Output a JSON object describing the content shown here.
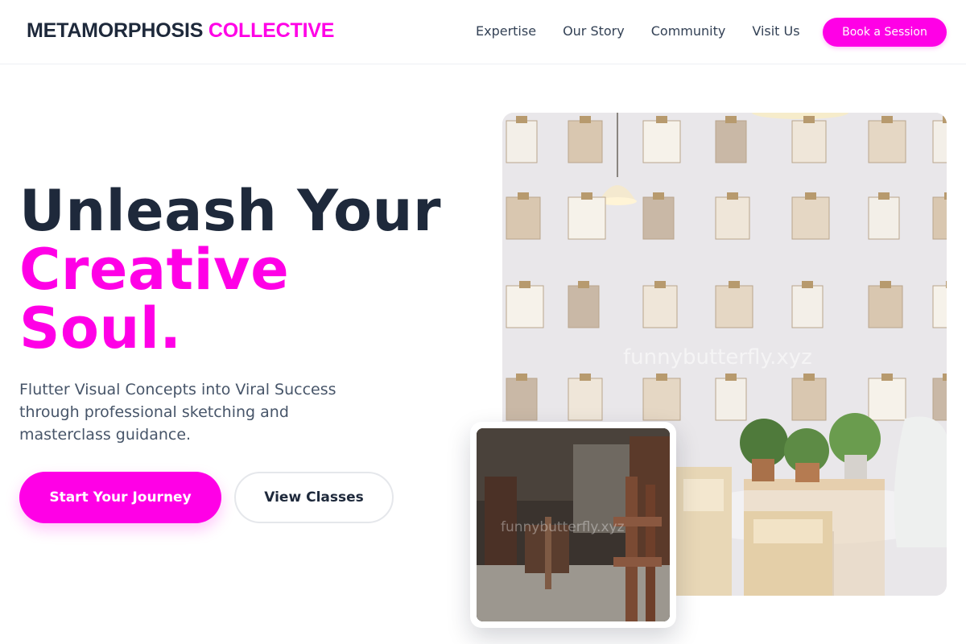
{
  "brand": {
    "part1": "METAMORPHOSIS",
    "part2": "COLLECTIVE"
  },
  "nav": {
    "items": [
      "Expertise",
      "Our Story",
      "Community",
      "Visit Us"
    ],
    "cta": "Book a Session"
  },
  "hero": {
    "headline_line1": "Unleash Your",
    "headline_line2": "Creative",
    "headline_line3": "Soul.",
    "subtext": "Flutter Visual Concepts into Viral Success through professional sketching and masterclass guidance.",
    "primary_cta": "Start Your Journey",
    "secondary_cta": "View Classes"
  },
  "images": {
    "main_alt": "Gallery wall with clipboards of magazines and a round table with plants",
    "main_watermark": "funnybutterfly.xyz",
    "inset_alt": "Artist studio with wooden chairs",
    "inset_watermark": "funnybutterfly.xyz"
  },
  "colors": {
    "accent": "#ff00e6",
    "dark": "#1e293b",
    "muted": "#475569"
  }
}
